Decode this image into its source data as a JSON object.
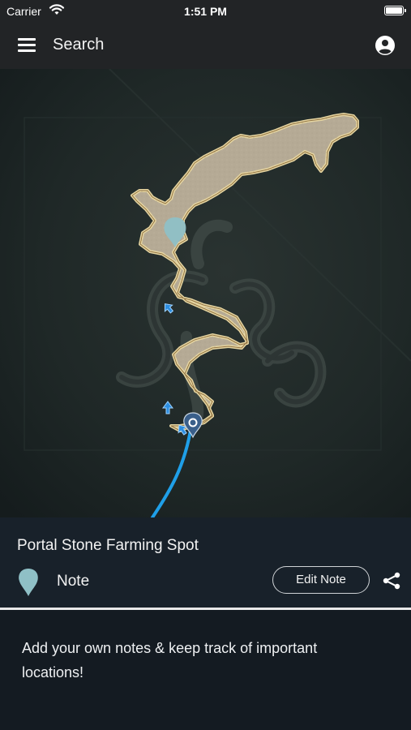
{
  "status_bar": {
    "carrier": "Carrier",
    "time": "1:51 PM",
    "icons": [
      "wifi-icon",
      "battery-icon"
    ]
  },
  "header": {
    "title": "Search",
    "icons": [
      "hamburger-menu-icon",
      "account-icon"
    ]
  },
  "map": {
    "icons": [
      "note-pin-icon",
      "portal-marker-icon",
      "arrow-icon"
    ],
    "colors": {
      "route": "#1f9fe8",
      "terrain": "#b7ac98",
      "terrain_edge": "#e6d6a2",
      "note_pin": "#8fc0c6"
    }
  },
  "location": {
    "title": "Portal Stone Farming Spot",
    "category": "Note",
    "edit_label": "Edit Note",
    "icons": [
      "pin-icon",
      "share-icon"
    ],
    "pin_color": "#8fc0c6"
  },
  "note": {
    "text": "Add your own notes & keep track of important locations!"
  }
}
